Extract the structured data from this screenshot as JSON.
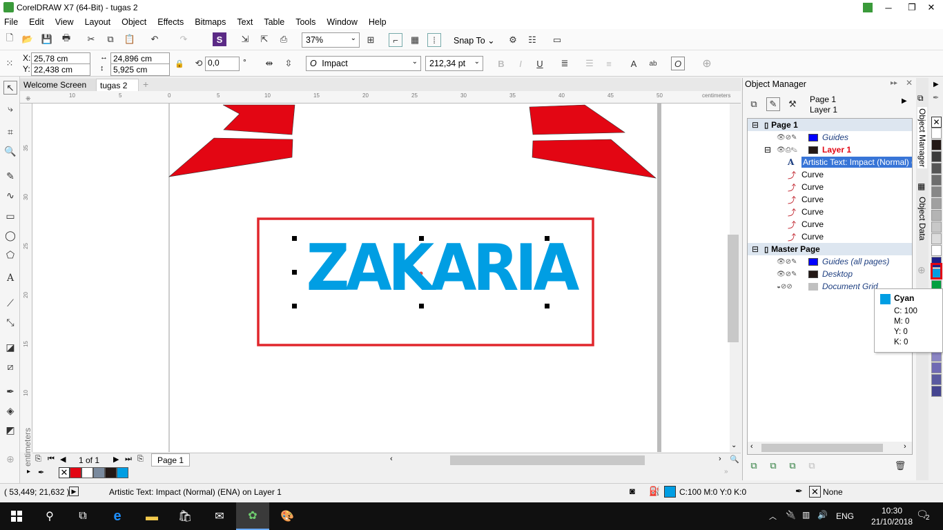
{
  "window": {
    "title": "CorelDRAW X7 (64-Bit) - tugas 2"
  },
  "menu": [
    "File",
    "Edit",
    "View",
    "Layout",
    "Object",
    "Effects",
    "Bitmaps",
    "Text",
    "Table",
    "Tools",
    "Window",
    "Help"
  ],
  "toolbar": {
    "zoom": "37%",
    "snap_to": "Snap To"
  },
  "properties": {
    "x": "25,78 cm",
    "y": "22,438 cm",
    "width": "24,896 cm",
    "height": "5,925 cm",
    "rotation": "0,0",
    "degree_symbol": "°",
    "font": "Impact",
    "font_size": "212,34 pt"
  },
  "doc_tabs": [
    "Welcome Screen",
    "tugas 2"
  ],
  "ruler": {
    "h_ticks": [
      "10",
      "5",
      "0",
      "5",
      "10",
      "15",
      "20",
      "25",
      "30",
      "35",
      "40",
      "45",
      "50"
    ],
    "v_ticks": [
      "35",
      "30",
      "25",
      "20",
      "15",
      "10"
    ],
    "unit": "centimeters"
  },
  "canvas": {
    "text": "ZAKARIA",
    "text_color": "#009ee3",
    "frame_color": "#e0262c",
    "star_color": "#e30613"
  },
  "page_nav": {
    "counter": "1 of 1",
    "page_tab": "Page 1"
  },
  "object_manager": {
    "title": "Object Manager",
    "page": "Page 1",
    "layer": "Layer 1",
    "rows": [
      {
        "label": "Page 1",
        "type": "section"
      },
      {
        "label": "Guides",
        "color": "#0000ff"
      },
      {
        "label": "Layer 1",
        "color": "#231815"
      },
      {
        "label": "Artistic Text: Impact (Normal) o"
      },
      {
        "label": "Curve"
      },
      {
        "label": "Curve"
      },
      {
        "label": "Curve"
      },
      {
        "label": "Curve"
      },
      {
        "label": "Curve"
      },
      {
        "label": "Curve"
      },
      {
        "label": "Master Page",
        "type": "section"
      },
      {
        "label": "Guides (all pages)",
        "color": "#0000ff"
      },
      {
        "label": "Desktop",
        "color": "#231815"
      },
      {
        "label": "Document Grid",
        "color": "#c0c0c0"
      }
    ]
  },
  "docker_tabs": [
    "Object Manager",
    "Object Data"
  ],
  "tooltip": {
    "name": "Cyan",
    "c": "C: 100",
    "m": "M: 0",
    "y": "Y: 0",
    "k": "K: 0"
  },
  "status": {
    "coords": "( 53,449; 21,632 )",
    "object_info": "Artistic Text: Impact (Normal) (ENA) on Layer 1",
    "fill": "C:100 M:0 Y:0 K:0",
    "outline": "None"
  },
  "taskbar": {
    "lang": "ENG",
    "time": "10:30",
    "date": "21/10/2018",
    "notifications": "2"
  },
  "palette_colors": [
    "#ffffff",
    "#231815",
    "#3c3c3c",
    "#555555",
    "#6e6e6e",
    "#878787",
    "#a0a0a0",
    "#b4b4b4",
    "#c8c8c8",
    "#dcdcdc",
    "#ffffff",
    "#1d2088",
    "#009ee3",
    "#00a040",
    "#e84c3d",
    "#ee7f7a",
    "#c9a0b4",
    "#b8b0d8",
    "#9f9ad0",
    "#8b85c4",
    "#706ab4",
    "#5a5aa0",
    "#454590"
  ],
  "doc_palette_colors": [
    "#e30613",
    "#ffffff",
    "#7a8a9e",
    "#231815",
    "#009ee3"
  ]
}
